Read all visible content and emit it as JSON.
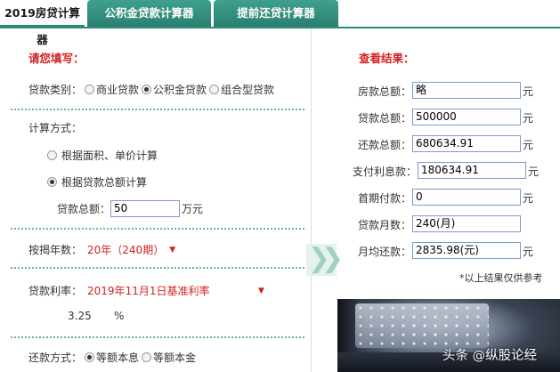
{
  "tabs": [
    {
      "label": "2019房贷计算器",
      "active": true
    },
    {
      "label": "公积金贷款计算器",
      "active": false
    },
    {
      "label": "提前还贷计算器",
      "active": false
    }
  ],
  "form": {
    "title": "请您填写：",
    "loan_type": {
      "label": "贷款类别：",
      "options": [
        "商业贷款",
        "公积金贷款",
        "组合型贷款"
      ],
      "selected": "公积金贷款"
    },
    "calc_method": {
      "label": "计算方式：",
      "options": [
        "根据面积、单价计算",
        "根据贷款总额计算"
      ],
      "selected": "根据贷款总额计算"
    },
    "loan_total": {
      "label": "贷款总额：",
      "value": "50",
      "unit": "万元"
    },
    "years": {
      "label": "按揭年数：",
      "value": "20年（240期）"
    },
    "rate": {
      "label": "贷款利率：",
      "value": "2019年11月1日基准利率",
      "percent": "3.25",
      "unit": "%"
    },
    "repay": {
      "label": "还款方式：",
      "options": [
        "等额本息",
        "等额本金"
      ],
      "selected": "等额本息"
    }
  },
  "results": {
    "title": "查看结果：",
    "rows": [
      {
        "label": "房款总额：",
        "value": "略",
        "unit": "元"
      },
      {
        "label": "贷款总额：",
        "value": "500000",
        "unit": "元"
      },
      {
        "label": "还款总额：",
        "value": "680634.91",
        "unit": "元"
      },
      {
        "label": "支付利息款：",
        "value": "180634.91",
        "unit": "元"
      },
      {
        "label": "首期付款：",
        "value": "0",
        "unit": "元"
      },
      {
        "label": "贷款月数：",
        "value": "240(月)",
        "unit": ""
      },
      {
        "label": "月均还款：",
        "value": "2835.98(元)",
        "unit": "元"
      }
    ],
    "note": "*以上结果仅供参考"
  },
  "watermark": "头条 @纵股论经",
  "colors": {
    "accent": "#2c8a7a",
    "label_red": "#d42020",
    "input_border": "#7a9cc8"
  }
}
